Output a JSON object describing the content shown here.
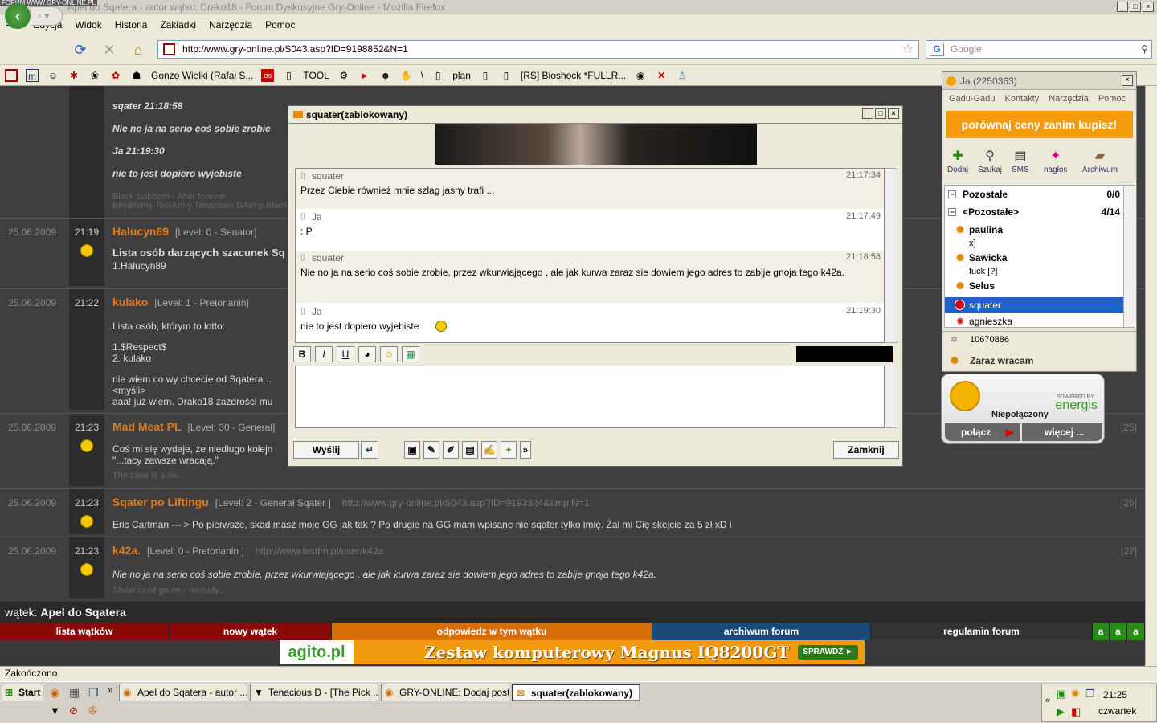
{
  "browser": {
    "watermark": "FORUM WWW.GRY-ONLINE.PL",
    "title": "Apel do Sqatera - autor wątku: Drako18 - Forum Dyskusyjne Gry-Online - Mozilla Firefox",
    "menu": [
      "Plik",
      "Edycja",
      "Widok",
      "Historia",
      "Zakładki",
      "Narzędzia",
      "Pomoc"
    ],
    "url": "http://www.gry-online.pl/S043.asp?ID=9198852&N=1",
    "search_placeholder": "Google",
    "bookmarks": [
      "Gonzo Wielki (Rafał S...",
      "TOOL",
      "\\",
      "plan",
      "[RS] Bioshock *FULLR..."
    ],
    "status": "Zakończono"
  },
  "forum": {
    "top_post": {
      "lines": [
        "sqater 21:18:58",
        "Nie no ja na serio coś sobie zrobie",
        "Ja 21:19:30",
        "nie to jest dopiero wyjebiste"
      ],
      "sig1": "Black Sabbath - After forever",
      "sig2": "BlindArmy ToolArmy Tenacious DArmy Black"
    },
    "posts": [
      {
        "date": "25.06.2009",
        "time": "21:19",
        "author": "Halucyn89",
        "level": "[Level: 0 - Senator]",
        "link": "",
        "num": "",
        "body": [
          "Lista osób darzących szacunek Sq",
          "1.Halucyn89"
        ],
        "sig": ""
      },
      {
        "date": "25.06.2009",
        "time": "21:22",
        "author": "kulako",
        "level": "[Level: 1 - Pretorianin]",
        "link": "",
        "num": "",
        "body": [
          "Lista osób, którym to lotto:",
          "",
          "1.$Respect$",
          "2. kulako",
          "",
          "nie wiem co wy chcecie od Sqatera...",
          "<myśli>",
          "aaa! już wiem. Drako18 zazdrości mu"
        ],
        "sig": ""
      },
      {
        "date": "25.06.2009",
        "time": "21:23",
        "author": "Mad Meat PL",
        "level": "[Level: 30 - Generał]",
        "link": "",
        "num": "[25]",
        "body": [
          "Coś mi się wydaje, że niedługo kolejn",
          "\"...tacy zawsze wracają.\""
        ],
        "sig": "The cake is a lie..."
      },
      {
        "date": "25.06.2009",
        "time": "21:23",
        "author": "Sqater po Liftingu",
        "level": "[Level: 2 - Generał Sqater ]",
        "link": "http://www.gry-online.pl/S043.asp?ID=9193324&amp;N=1",
        "num": "[26]",
        "body": [
          "Eric Cartman --- > Po pierwsze, skąd masz moje GG jak tak ? Po drugie na GG mam wpisane nie sqater tylko imię. Żal mi Cię skejcie za 5 zł xD i"
        ],
        "sig": ""
      },
      {
        "date": "25.06.2009",
        "time": "21:23",
        "author": "k42a.",
        "level": "[Level: 0 - Pretorianin ]",
        "link": "http://www.lastfm.pl/user/k42a",
        "num": "[27]",
        "body": [
          "Nie no ja na serio coś sobie zrobie, przez wkurwiającego , ale jak kurwa zaraz sie dowiem jego adres to zabije gnoja tego k42a."
        ],
        "sig": "Show must go on - niestety..."
      }
    ],
    "thread_label": "wątek:",
    "thread_name": "Apel do Sqatera",
    "nav": [
      "lista wątków",
      "nowy wątek",
      "odpowiedz w tym wątku",
      "archiwum forum",
      "regulamin forum"
    ],
    "font_buttons": [
      "a",
      "a",
      "a"
    ],
    "ad": {
      "brand": "agito.pl",
      "slogan": "Zestaw komputerowy Magnus IQ8200GT",
      "button": "SPRAWDŹ ►"
    }
  },
  "chat": {
    "title": "squater(zablokowany)",
    "messages": [
      {
        "who": "squater",
        "time": "21:17:34",
        "text": "Przez Ciebie również mnie szlag jasny trafi ..."
      },
      {
        "who": "Ja",
        "time": "21:17:49",
        "text": ": P"
      },
      {
        "who": "squater",
        "time": "21:18:58",
        "text": "Nie no ja na serio coś sobie zrobie, przez wkurwiającego , ale jak kurwa zaraz sie dowiem jego adres to zabije gnoja tego k42a."
      },
      {
        "who": "Ja",
        "time": "21:19:30",
        "text": "nie to jest dopiero wyjebiste"
      }
    ],
    "format": [
      "B",
      "I",
      "U"
    ],
    "send": "Wyślij",
    "close": "Zamknij"
  },
  "gg": {
    "title": "Ja (2250363)",
    "menu": [
      "Gadu-Gadu",
      "Kontakty",
      "Narzędzia",
      "Pomoc"
    ],
    "ad": "porównaj ceny zanim kupisz!",
    "tools": [
      "Dodaj",
      "Szukaj",
      "SMS",
      "nagłos",
      "Archiwum"
    ],
    "groups": [
      {
        "name": "Pozostałe",
        "count": "0/0"
      },
      {
        "name": "<Pozostałe>",
        "count": "4/14"
      }
    ],
    "contacts": [
      {
        "name": "paulina",
        "desc": "x]"
      },
      {
        "name": "Sawicka",
        "desc": "fuck [?]"
      },
      {
        "name": "Selus",
        "desc": ""
      },
      {
        "name": "squater",
        "desc": ""
      },
      {
        "name": "agnieszka",
        "desc": ""
      }
    ],
    "number": "10670886",
    "status": "Zaraz wracam"
  },
  "energis": {
    "powered": "POWERED BY",
    "brand": "energis",
    "state": "Niepołączony",
    "connect": "połącz",
    "more": "więcej ..."
  },
  "taskbar": {
    "start": "Start",
    "tasks": [
      "Apel do Sqatera - autor ...",
      "Tenacious D - [The Pick ...",
      "GRY-ONLINE: Dodaj post...",
      "squater(zablokowany)"
    ],
    "clock": "21:25",
    "day": "czwartek"
  }
}
